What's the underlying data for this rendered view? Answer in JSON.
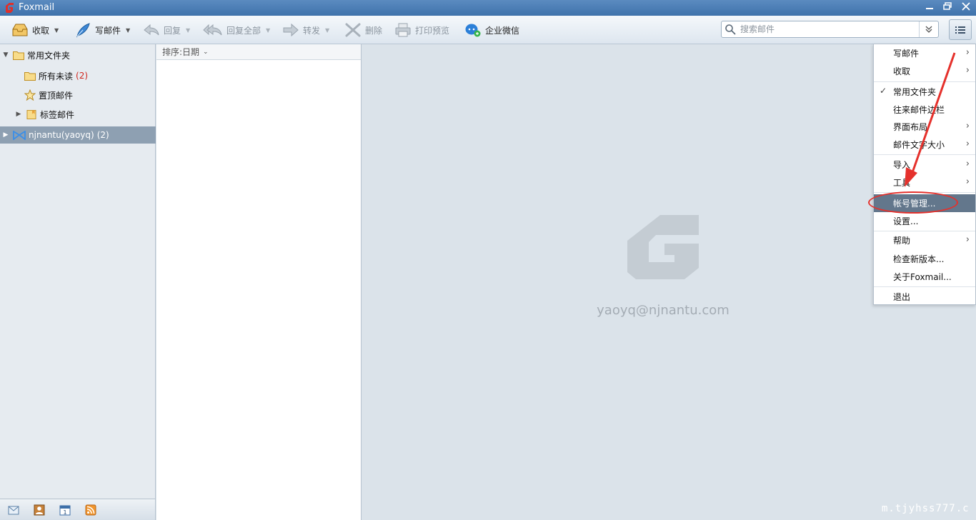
{
  "titlebar": {
    "title": "Foxmail"
  },
  "toolbar": {
    "receive": "收取",
    "compose": "写邮件",
    "reply": "回复",
    "reply_all": "回复全部",
    "forward": "转发",
    "delete": "删除",
    "print_preview": "打印预览",
    "wework": "企业微信",
    "search_placeholder": "搜索邮件"
  },
  "folders": {
    "common": "常用文件夹",
    "all_unread": "所有未读",
    "all_unread_count": "(2)",
    "pinned": "置顶邮件",
    "tagged": "标签邮件",
    "account": "njnantu(yaoyq)",
    "account_count": "(2)"
  },
  "list": {
    "sort_label": "排序:日期"
  },
  "preview": {
    "account_email": "yaoyq@njnantu.com"
  },
  "menu": {
    "compose": "写邮件",
    "receive": "收取",
    "common_folders": "常用文件夹",
    "contacts_bar": "往来邮件边栏",
    "layout": "界面布局",
    "font_size": "邮件文字大小",
    "import": "导入",
    "tools": "工具",
    "account_manage": "帐号管理...",
    "settings": "设置...",
    "help": "帮助",
    "check_update": "检查新版本...",
    "about": "关于Foxmail...",
    "exit": "退出"
  },
  "watermark": "m.tjyhss777.c",
  "colors": {
    "accent": "#3f72ab",
    "selected": "#63778c",
    "annotation": "#e5312c"
  }
}
